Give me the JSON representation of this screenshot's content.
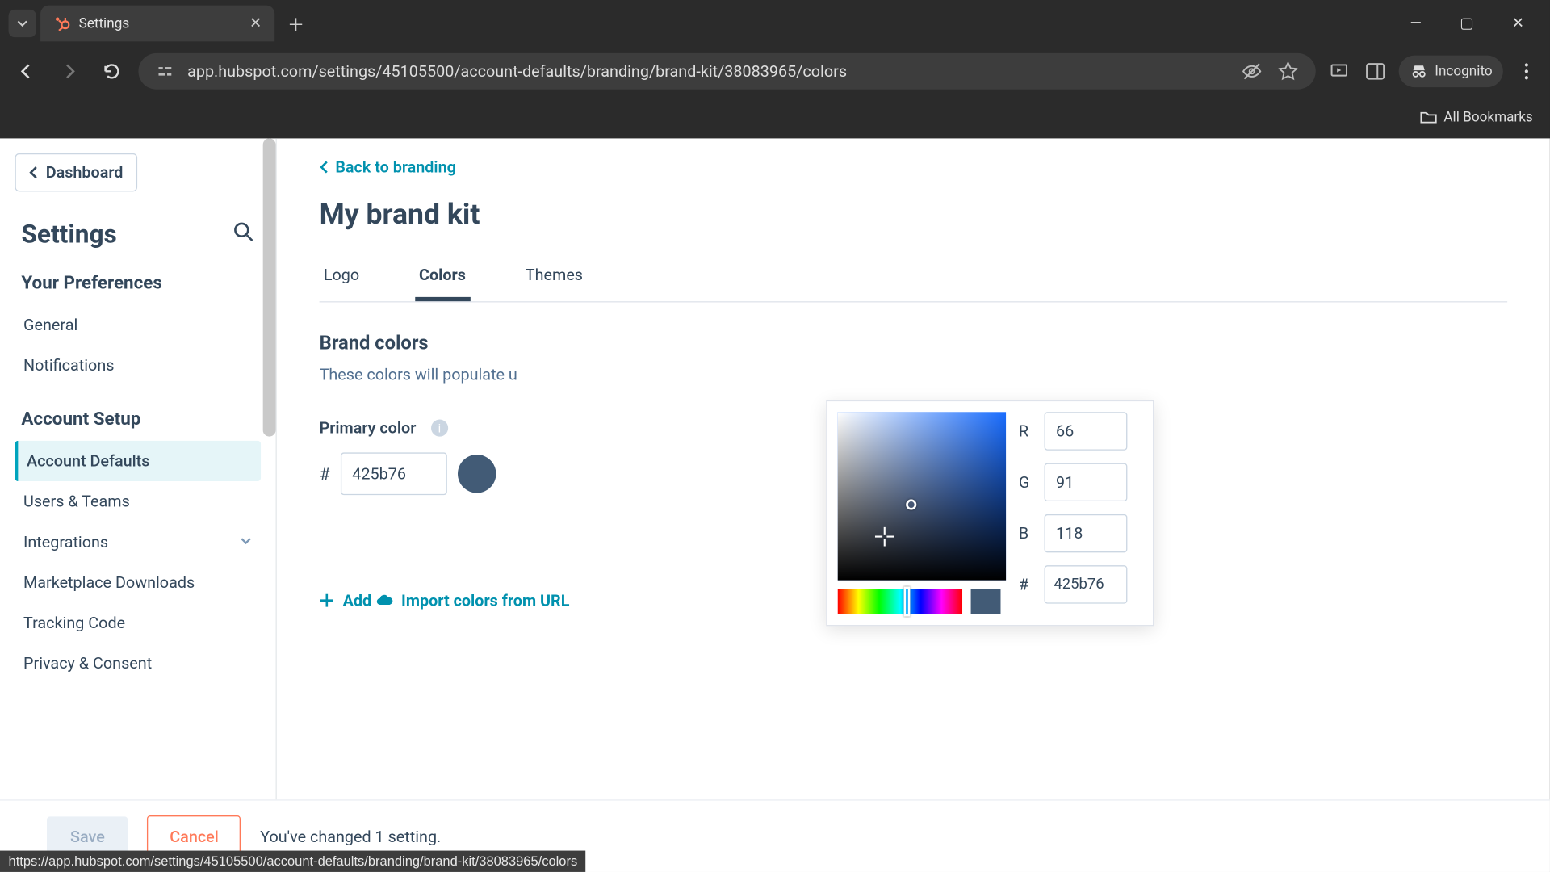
{
  "browser": {
    "tab_title": "Settings",
    "url": "app.hubspot.com/settings/45105500/account-defaults/branding/brand-kit/38083965/colors",
    "incognito_label": "Incognito",
    "bookmarks_label": "All Bookmarks",
    "status_url": "https://app.hubspot.com/settings/45105500/account-defaults/branding/brand-kit/38083965/colors"
  },
  "sidebar": {
    "dashboard": "Dashboard",
    "title": "Settings",
    "prefs_header": "Your Preferences",
    "prefs": {
      "general": "General",
      "notifications": "Notifications"
    },
    "setup_header": "Account Setup",
    "setup": {
      "account_defaults": "Account Defaults",
      "users_teams": "Users & Teams",
      "integrations": "Integrations",
      "marketplace": "Marketplace Downloads",
      "tracking": "Tracking Code",
      "privacy": "Privacy & Consent"
    }
  },
  "main": {
    "back_label": "Back to branding",
    "title": "My brand kit",
    "tabs": {
      "logo": "Logo",
      "colors": "Colors",
      "themes": "Themes"
    },
    "section_header": "Brand colors",
    "section_desc": "These colors will populate u",
    "primary_label": "Primary color",
    "hex_value": "425b76",
    "add_label": "Add",
    "import_label": "Import colors from URL"
  },
  "picker": {
    "r_label": "R",
    "g_label": "G",
    "b_label": "B",
    "hash": "#",
    "r": "66",
    "g": "91",
    "b": "118",
    "hex": "425b76",
    "swatch_color": "#425b76"
  },
  "footer": {
    "save": "Save",
    "cancel": "Cancel",
    "message": "You've changed 1 setting."
  }
}
